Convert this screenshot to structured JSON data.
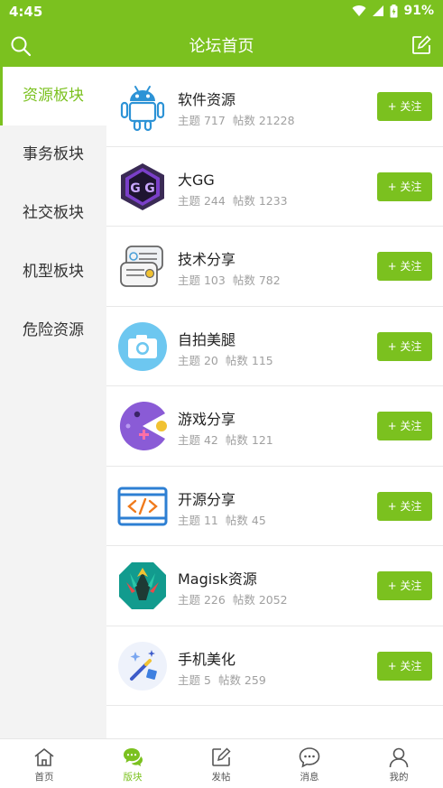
{
  "status": {
    "time": "4:45",
    "battery": "91%"
  },
  "header": {
    "title": "论坛首页"
  },
  "sidebar": {
    "items": [
      {
        "label": "资源板块",
        "active": true
      },
      {
        "label": "事务板块",
        "active": false
      },
      {
        "label": "社交板块",
        "active": false
      },
      {
        "label": "机型板块",
        "active": false
      },
      {
        "label": "危险资源",
        "active": false
      }
    ]
  },
  "forums": [
    {
      "name": "软件资源",
      "topics": "主题 717",
      "posts": "帖数 21228",
      "button": "+ 关注",
      "icon": "android-robot-icon"
    },
    {
      "name": "大GG",
      "topics": "主题 244",
      "posts": "帖数 1233",
      "button": "+ 关注",
      "icon": "gameguardian-icon"
    },
    {
      "name": "技术分享",
      "topics": "主题 103",
      "posts": "帖数 782",
      "button": "+ 关注",
      "icon": "chat-bubbles-icon"
    },
    {
      "name": "自拍美腿",
      "topics": "主题 20",
      "posts": "帖数 115",
      "button": "+ 关注",
      "icon": "camera-icon"
    },
    {
      "name": "游戏分享",
      "topics": "主题 42",
      "posts": "帖数 121",
      "button": "+ 关注",
      "icon": "pacman-icon"
    },
    {
      "name": "开源分享",
      "topics": "主题 11",
      "posts": "帖数 45",
      "button": "+ 关注",
      "icon": "code-window-icon"
    },
    {
      "name": "Magisk资源",
      "topics": "主题 226",
      "posts": "帖数 2052",
      "button": "+ 关注",
      "icon": "magisk-icon"
    },
    {
      "name": "手机美化",
      "topics": "主题 5",
      "posts": "帖数 259",
      "button": "+ 关注",
      "icon": "magic-wand-icon"
    }
  ],
  "bottom_nav": {
    "items": [
      {
        "label": "首页",
        "icon": "home-icon",
        "active": false
      },
      {
        "label": "版块",
        "icon": "chat-bubbles-icon",
        "active": true
      },
      {
        "label": "发帖",
        "icon": "compose-icon",
        "active": false
      },
      {
        "label": "消息",
        "icon": "message-icon",
        "active": false
      },
      {
        "label": "我的",
        "icon": "person-icon",
        "active": false
      }
    ]
  },
  "colors": {
    "accent": "#7bc11f",
    "sidebar_bg": "#f3f3f3",
    "muted_text": "#a0a0a0"
  }
}
